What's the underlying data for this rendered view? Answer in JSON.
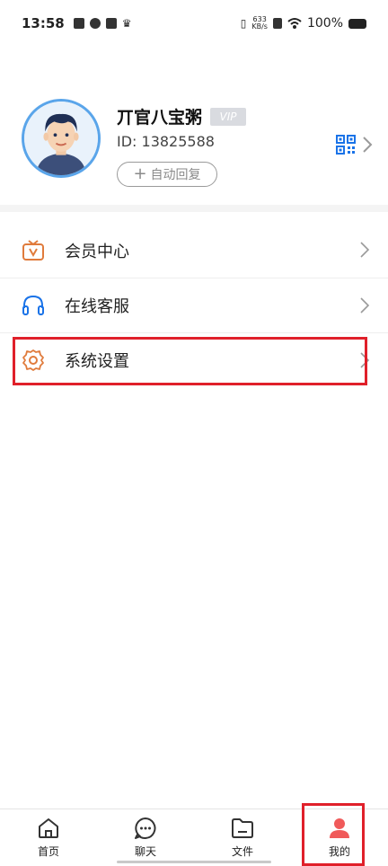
{
  "status_bar": {
    "time": "13:58",
    "net_speed_value": "633",
    "net_speed_unit": "KB/s",
    "battery": "100%"
  },
  "profile": {
    "name": "丌官八宝粥",
    "vip_label": "VIP",
    "user_id": "ID: 13825588",
    "auto_reply_label": "自动回复"
  },
  "menu": {
    "items": [
      {
        "label": "会员中心",
        "icon": "tv-vip-icon"
      },
      {
        "label": "在线客服",
        "icon": "headset-icon"
      },
      {
        "label": "系统设置",
        "icon": "gear-icon"
      }
    ]
  },
  "nav": {
    "items": [
      {
        "label": "首页",
        "icon": "home-icon"
      },
      {
        "label": "聊天",
        "icon": "chat-icon"
      },
      {
        "label": "文件",
        "icon": "folder-icon"
      },
      {
        "label": "我的",
        "icon": "person-icon",
        "active": true
      }
    ]
  },
  "colors": {
    "accent_blue": "#1a73e8",
    "vip_gray": "#d9dbe0",
    "icon_orange": "#e07b3c",
    "highlight_red": "#e0202a",
    "active_person": "#f05a5a"
  }
}
